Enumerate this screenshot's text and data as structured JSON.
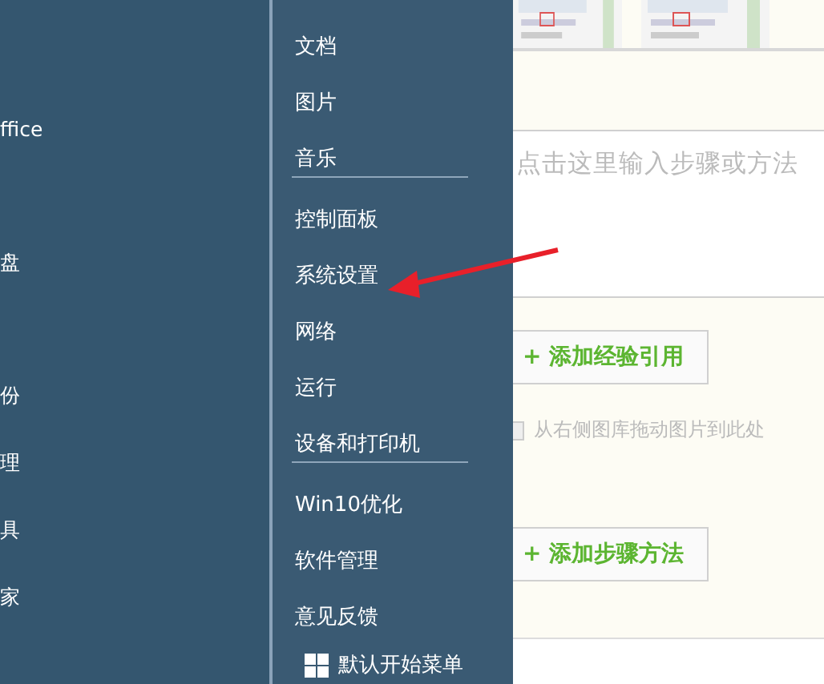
{
  "start_menu": {
    "left_column_items": [
      "ffice",
      "盘",
      "份",
      "理",
      "具",
      "家"
    ],
    "sections": [
      [
        "文档",
        "图片",
        "音乐"
      ],
      [
        "控制面板",
        "系统设置",
        "网络",
        "运行",
        "设备和打印机"
      ],
      [
        "Win10优化",
        "软件管理",
        "意见反馈"
      ]
    ],
    "footer_item": {
      "label": "默认开始菜单"
    }
  },
  "editor": {
    "step_placeholder": "点击这里输入步骤或方法",
    "reference_button": "+ 添加经验引用",
    "image_drop_hint": "从右侧图库拖动图片到此处",
    "step_button": "+ 添加步骤方法"
  }
}
